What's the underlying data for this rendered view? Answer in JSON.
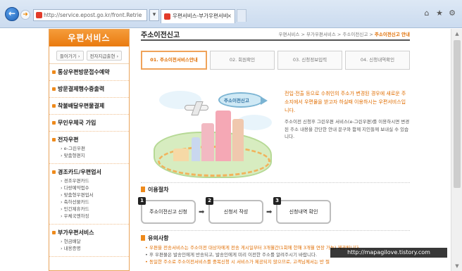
{
  "browser": {
    "address": "http://service.epost.go.kr/front.Retrie",
    "tab_title": "우편서비스-부가우편서비",
    "tab_close": "×",
    "back_glyph": "←",
    "forward_glyph": "➜",
    "search_glyph": "▾",
    "icons": {
      "home": "⌂",
      "favorites": "★",
      "settings": "⚙"
    }
  },
  "sidebar": {
    "title": "우편서비스",
    "buttons": [
      "들어가기 ›",
      "전자지급출현 ›"
    ],
    "items": [
      {
        "label": "통상우편방문접수예약",
        "subs": []
      },
      {
        "label": "방문결제행수증출력",
        "subs": []
      },
      {
        "label": "착불배달우편물결제",
        "subs": []
      },
      {
        "label": "무인우체국 가입",
        "subs": []
      },
      {
        "label": "전자우편",
        "subs": [
          "› e-그린우편",
          "› 맞춤형편지"
        ]
      },
      {
        "label": "경조카드/우편업서",
        "subs": [
          "› 경조우편카드",
          "› 다량예약접수",
          "› 맞춤형우편업서",
          "› 축하선물카드",
          "› 민간제휴카드",
          "› 우체국엔하징"
        ]
      },
      {
        "label": "부가우편서비스",
        "subs": [
          "› 현금배달",
          "› 내용증명"
        ]
      }
    ]
  },
  "main": {
    "title": "주소이전신고",
    "breadcrumb": {
      "path": "우편서비스 > 부가우편서비스 > 주소이전신고 > ",
      "current": "주소이전신고 안내"
    },
    "steps": [
      "01. 주소이전서비스안내",
      "02. 회원확인",
      "03. 신청정보입력",
      "04. 신청내역확인"
    ],
    "active_step": 0,
    "illustration_label": "주소이전신고",
    "intro": "전입·전출 등으로 수취인의 주소가 변경된 경우에 새로운 주소지에서 우편물을 받고자 하실때 이용하시는 우편서비스입니다.",
    "intro_desc": "주소이전 신청후 그린우편 서비스(e-그린우편)를 이용하시면 변경된 주소 내용을 간단한 안내 문구와 함께 지인들께 보내실 수 있습니다.",
    "process_title": "이용절차",
    "process_steps": [
      {
        "num": "1",
        "label": "주소이전신고 신청"
      },
      {
        "num": "2",
        "label": "신청서 작성"
      },
      {
        "num": "3",
        "label": "신청내역 확인"
      }
    ],
    "arrow": "➡",
    "notes_title": "유의사항",
    "notes": [
      {
        "text": "우편을 전송서비스는 주소이전 대상자에게 전송 게시일부터 3개월간(1회에 한해 3개월 연장 가능) 제공됩니다.",
        "plain": false
      },
      {
        "text": "후 우편물은 발송인에게 반송되고, 발송인에게 미리 이전한 주소를 알려주시기 바랍니다.",
        "plain": true
      },
      {
        "text": "동일한 주소로 주소이전서비스를 중복신청 시 서비스가 제공되지 않으므로, 고객님께서는 반 절",
        "plain": false
      }
    ]
  },
  "scrollbar": {
    "up": "▲",
    "down": "▼"
  },
  "watermark": "http://mapagilove.tistory.com",
  "colors": {
    "accent": "#ee8a1c",
    "accent_text": "#e06d00",
    "chrome": "#cbdbef"
  }
}
